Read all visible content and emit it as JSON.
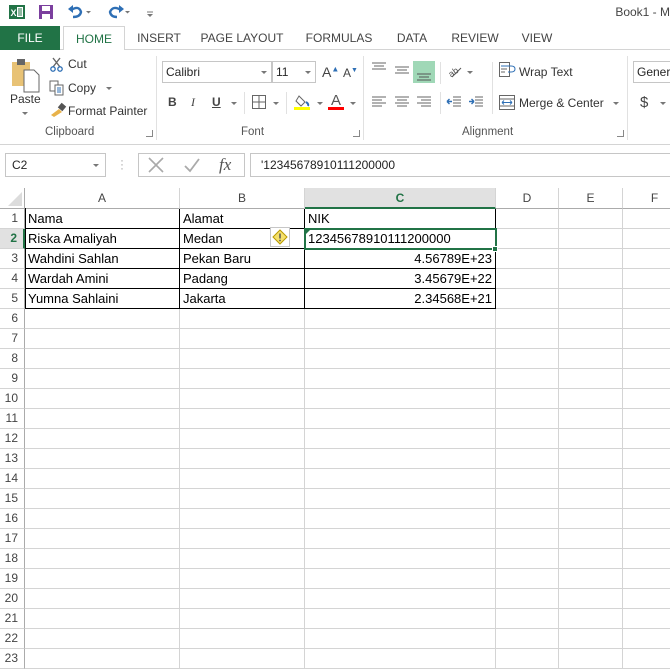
{
  "app": {
    "title": "Book1 - M",
    "quick_access": [
      "excel-logo-icon",
      "save-icon",
      "undo-icon",
      "redo-icon",
      "customize-qat-icon"
    ]
  },
  "tabs": [
    {
      "label": "FILE",
      "active": false
    },
    {
      "label": "HOME",
      "active": true
    },
    {
      "label": "INSERT",
      "active": false
    },
    {
      "label": "PAGE LAYOUT",
      "active": false
    },
    {
      "label": "FORMULAS",
      "active": false
    },
    {
      "label": "DATA",
      "active": false
    },
    {
      "label": "REVIEW",
      "active": false
    },
    {
      "label": "VIEW",
      "active": false
    }
  ],
  "ribbon": {
    "clipboard": {
      "label": "Clipboard",
      "paste": "Paste",
      "cut": "Cut",
      "copy": "Copy",
      "format_painter": "Format Painter"
    },
    "font": {
      "label": "Font",
      "font_name": "Calibri",
      "font_size": "11",
      "bold": "B",
      "italic": "I",
      "underline": "U",
      "fill_color": "#ffff00",
      "font_color": "#ff0000"
    },
    "alignment": {
      "label": "Alignment",
      "wrap_text": "Wrap Text",
      "merge_center": "Merge & Center"
    },
    "number": {
      "format": "Genera",
      "currency": "$"
    }
  },
  "formula_bar": {
    "name_box": "C2",
    "fx": "fx",
    "formula": "'12345678910111200000"
  },
  "grid": {
    "columns": [
      "A",
      "B",
      "C",
      "D",
      "E",
      "F"
    ],
    "selected_column": "C",
    "selected_row": 2,
    "rows": [
      1,
      2,
      3,
      4,
      5,
      6,
      7,
      8,
      9,
      10,
      11,
      12,
      13,
      14,
      15,
      16,
      17,
      18,
      19,
      20,
      21,
      22,
      23
    ],
    "data": [
      {
        "row": 1,
        "A": "Nama",
        "B": "Alamat",
        "C": "NIK"
      },
      {
        "row": 2,
        "A": "Riska Amaliyah",
        "B": "Medan",
        "C": "12345678910111200000"
      },
      {
        "row": 3,
        "A": "Wahdini Sahlan",
        "B": "Pekan Baru",
        "C": "4.56789E+23"
      },
      {
        "row": 4,
        "A": "Wardah Amini",
        "B": "Padang",
        "C": "3.45679E+22"
      },
      {
        "row": 5,
        "A": "Yumna Sahlaini",
        "B": "Jakarta",
        "C": "2.34568E+21"
      }
    ]
  },
  "colors": {
    "accent": "#217346",
    "header_selected_bg": "#e1e1e1"
  }
}
